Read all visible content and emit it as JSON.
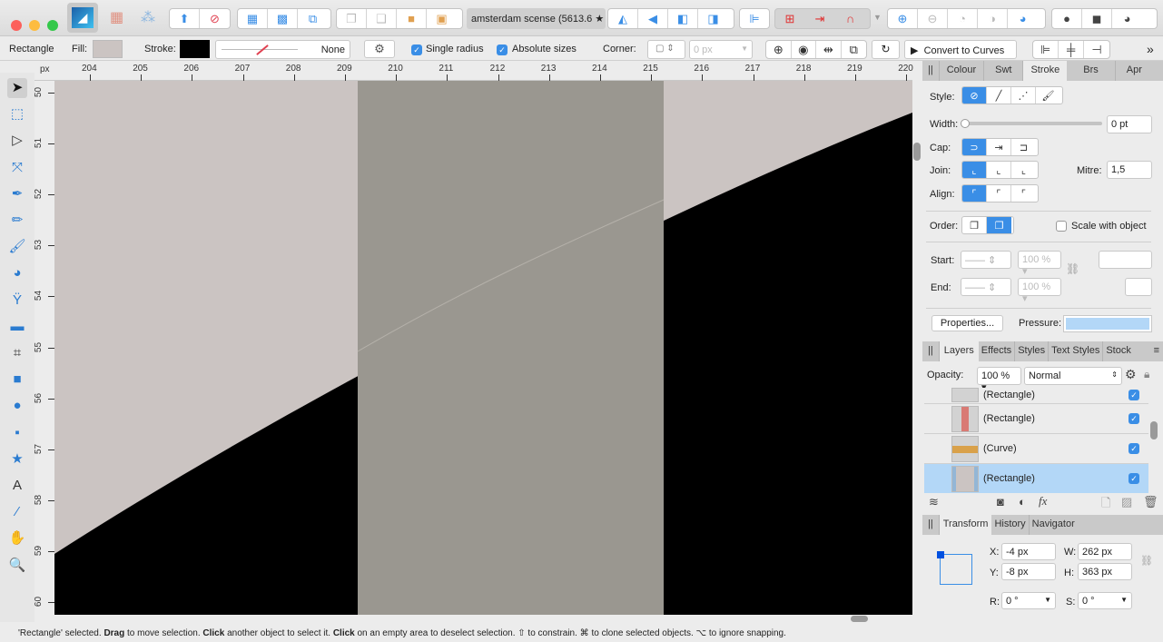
{
  "window": {
    "document_tab": "amsterdam scense (5613.6 ★"
  },
  "context_toolbar": {
    "object_type": "Rectangle",
    "fill_label": "Fill:",
    "fill_color": "#cbc4c2",
    "stroke_label": "Stroke:",
    "stroke_color": "#000000",
    "stroke_value": "None",
    "single_radius": "Single radius",
    "absolute_sizes": "Absolute sizes",
    "corner_label": "Corner:",
    "corner_value": "0 px",
    "convert_to_curves": "Convert to Curves"
  },
  "rulers": {
    "unit": "px",
    "h_ticks": [
      "204",
      "205",
      "206",
      "207",
      "208",
      "209",
      "210",
      "211",
      "212",
      "213",
      "214",
      "215",
      "216",
      "217",
      "218",
      "219",
      "220"
    ],
    "v_ticks": [
      "50",
      "51",
      "52",
      "53",
      "54",
      "55",
      "56",
      "57",
      "58",
      "59",
      "60"
    ]
  },
  "tools": [
    "move-tool",
    "artboard-tool",
    "node-tool",
    "point-transform-tool",
    "pen-tool",
    "pencil-tool",
    "vector-brush-tool",
    "fill-tool",
    "transparency-tool",
    "place-image-tool",
    "crop-tool",
    "rectangle-tool",
    "ellipse-tool",
    "rounded-rectangle-tool",
    "star-tool",
    "text-tool",
    "color-picker-tool",
    "view-tool",
    "zoom-tool"
  ],
  "stroke_panel": {
    "tabs": [
      "Colour",
      "Swt",
      "Stroke",
      "Brs",
      "Apr"
    ],
    "active_tab": "Stroke",
    "style_label": "Style:",
    "width_label": "Width:",
    "width_value": "0 pt",
    "width_fraction": 0,
    "cap_label": "Cap:",
    "join_label": "Join:",
    "mitre_label": "Mitre:",
    "mitre_value": "1,5",
    "align_label": "Align:",
    "order_label": "Order:",
    "scale_with_object": "Scale with object",
    "start_label": "Start:",
    "end_label": "End:",
    "start_pct": "100 %",
    "end_pct": "100 %",
    "properties_button": "Properties...",
    "pressure_label": "Pressure:"
  },
  "layers_panel": {
    "tabs": [
      "Layers",
      "Effects",
      "Styles",
      "Text Styles",
      "Stock"
    ],
    "opacity_label": "Opacity:",
    "opacity_value": "100 %",
    "blend_mode": "Normal",
    "items": [
      {
        "name": "(Rectangle)",
        "visible": true,
        "selected": false
      },
      {
        "name": "(Rectangle)",
        "visible": true,
        "selected": false
      },
      {
        "name": "(Curve)",
        "visible": true,
        "selected": false
      },
      {
        "name": "(Rectangle)",
        "visible": true,
        "selected": true
      }
    ]
  },
  "transform_panel": {
    "tabs": [
      "Transform",
      "History",
      "Navigator"
    ],
    "x_label": "X:",
    "x": "-4 px",
    "y_label": "Y:",
    "y": "-8 px",
    "w_label": "W:",
    "w": "262 px",
    "h_label": "H:",
    "h": "363 px",
    "r_label": "R:",
    "r": "0 °",
    "s_label": "S:",
    "s": "0 °"
  },
  "status": {
    "p1": "'Rectangle' selected. ",
    "b1": "Drag",
    "p2": " to move selection. ",
    "b2": "Click",
    "p3": " another object to select it. ",
    "b3": "Click",
    "p4": " on an empty area to deselect selection. ⇧ to constrain. ⌘ to clone selected objects. ⌥ to ignore snapping."
  },
  "colors": {
    "accent": "#3a8ee6",
    "canvas_bg": "#cbc4c2",
    "band": "#9a9790",
    "shape": "#000000"
  }
}
